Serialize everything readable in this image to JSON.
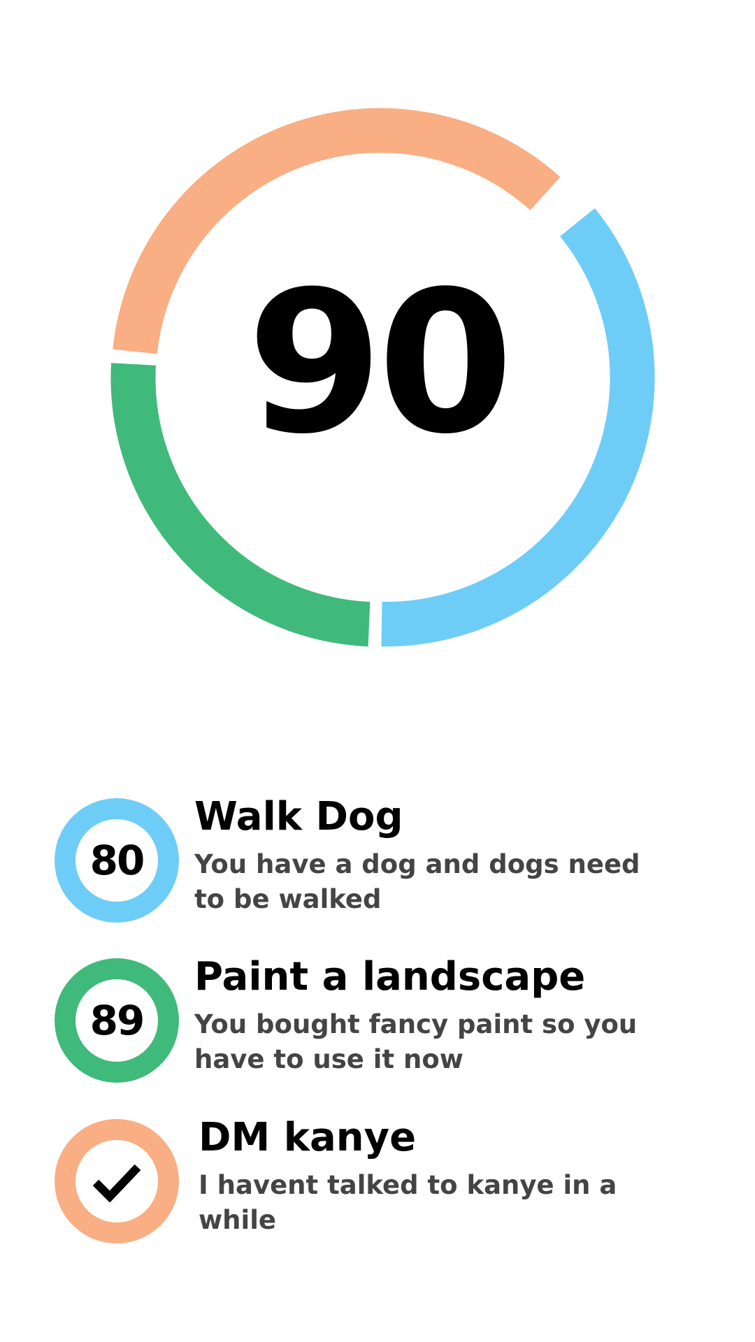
{
  "score": {
    "value": "90"
  },
  "colors": {
    "blue": "#6ecdf6",
    "green": "#3fba7a",
    "orange": "#f9ae84",
    "title_text": "#000000",
    "desc_text": "#444444"
  },
  "tasks": [
    {
      "badge": "80",
      "title": "Walk Dog",
      "description": "You have a dog and dogs need to be walked",
      "color": "blue",
      "completed": false
    },
    {
      "badge": "89",
      "title": "Paint a landscape",
      "description": "You bought fancy paint so you have to use it now",
      "color": "green",
      "completed": false
    },
    {
      "badge": "",
      "title": "DM kanye",
      "description": "I havent talked to kanye in a while",
      "color": "orange",
      "completed": true,
      "icon": "check-icon"
    }
  ]
}
